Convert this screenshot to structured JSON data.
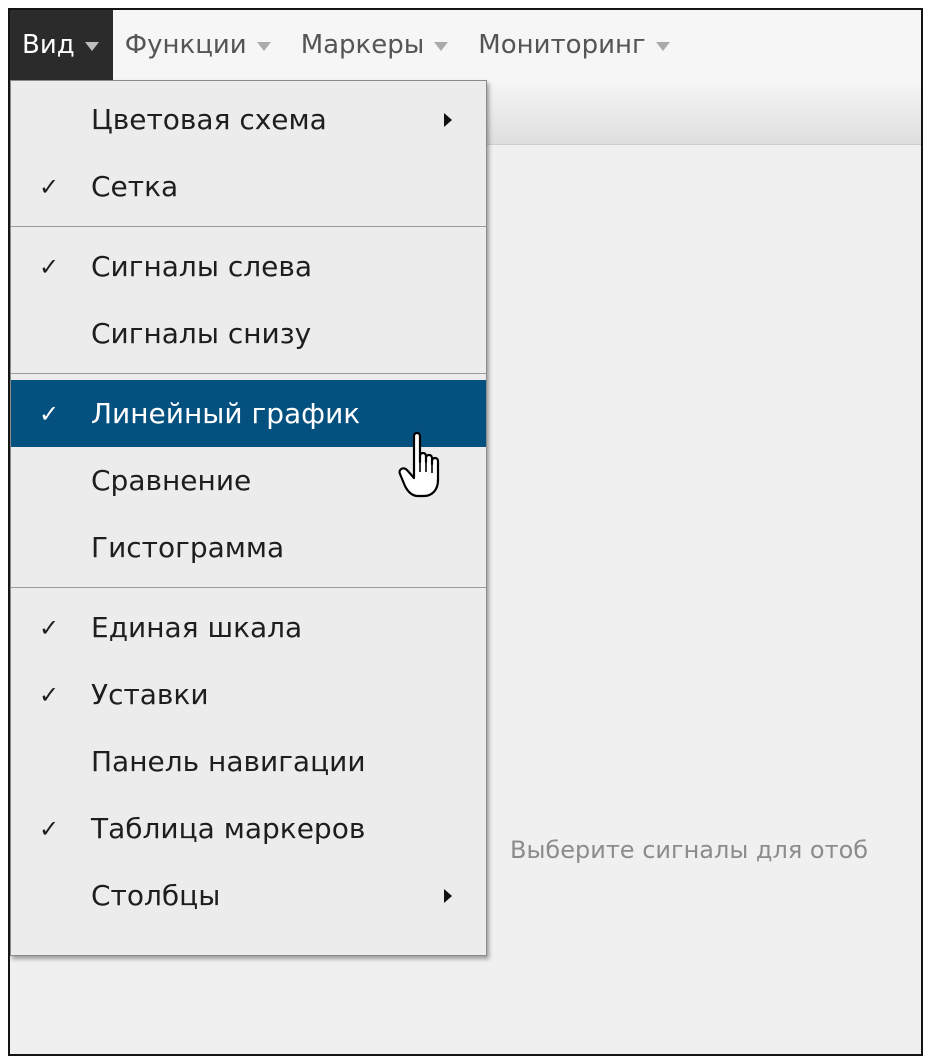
{
  "menubar": {
    "items": [
      {
        "label": "Вид",
        "active": true
      },
      {
        "label": "Функции",
        "active": false
      },
      {
        "label": "Маркеры",
        "active": false
      },
      {
        "label": "Мониторинг",
        "active": false
      }
    ]
  },
  "view_menu": {
    "items": [
      {
        "label": "Цветовая схема",
        "checked": false,
        "submenu": true
      },
      {
        "label": "Сетка",
        "checked": true
      },
      {
        "label": "Сигналы слева",
        "checked": true
      },
      {
        "label": "Сигналы снизу",
        "checked": false
      },
      {
        "label": "Линейный график",
        "checked": true,
        "highlighted": true
      },
      {
        "label": "Сравнение",
        "checked": false
      },
      {
        "label": "Гистограмма",
        "checked": false
      },
      {
        "label": "Единая шкала",
        "checked": true
      },
      {
        "label": "Уставки",
        "checked": true
      },
      {
        "label": "Панель навигации",
        "checked": false
      },
      {
        "label": "Таблица маркеров",
        "checked": true
      },
      {
        "label": "Столбцы",
        "checked": false,
        "submenu": true
      }
    ],
    "check_glyph": "✓"
  },
  "workspace": {
    "placeholder": "Выберите сигналы для отоб"
  },
  "colors": {
    "highlight": "#04507f",
    "active_menubar": "#2b2b2b"
  },
  "icons": {
    "cursor": "hand-pointer-icon",
    "dropdown": "caret-down-icon",
    "submenu": "caret-right-icon"
  }
}
